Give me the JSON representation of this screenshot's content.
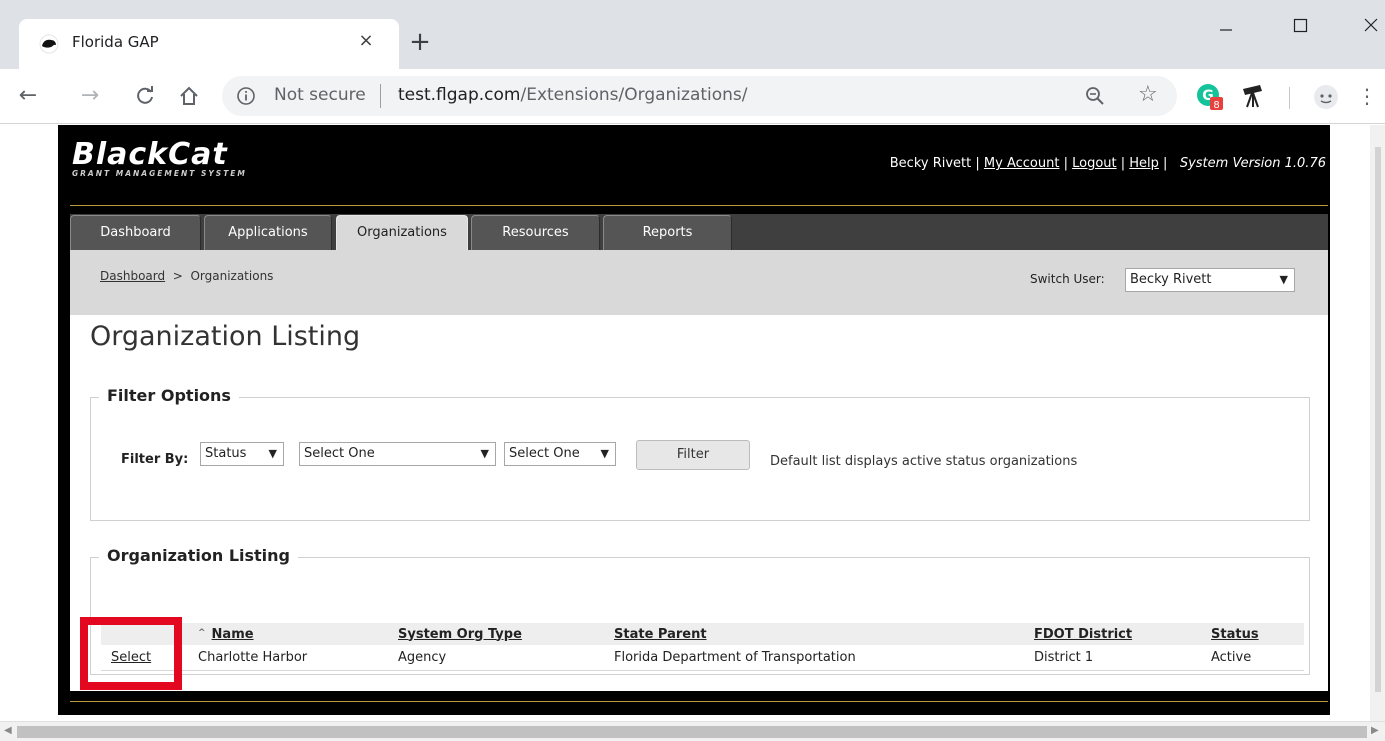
{
  "browser": {
    "tab_title": "Florida GAP",
    "tab_close": "×",
    "new_tab": "+",
    "minimize": "—",
    "close": "✕",
    "security_label": "Not secure",
    "url_host": "test.flgap.com",
    "url_path": "/Extensions/Organizations/",
    "extension_badge": "8"
  },
  "site": {
    "logo_text": "BlackCat",
    "logo_sub": "GRANT MANAGEMENT SYSTEM",
    "user_name": "Becky Rivett",
    "links": {
      "my_account": "My Account",
      "logout": "Logout",
      "help": "Help"
    },
    "separator": " | ",
    "version": "System Version  1.0.76"
  },
  "nav_tabs": [
    {
      "label": "Dashboard",
      "active": false
    },
    {
      "label": "Applications",
      "active": false
    },
    {
      "label": "Organizations",
      "active": true
    },
    {
      "label": "Resources",
      "active": false
    },
    {
      "label": "Reports",
      "active": false
    }
  ],
  "breadcrumb": {
    "home": "Dashboard",
    "separator": ">",
    "current": "Organizations"
  },
  "switch_user": {
    "label": "Switch User:",
    "value": "Becky Rivett"
  },
  "page_title": "Organization Listing",
  "filter": {
    "legend": "Filter Options",
    "label": "Filter By:",
    "select1": "Status",
    "select2": "Select One",
    "select3": "Select One",
    "button": "Filter",
    "note": "Default list displays active status organizations"
  },
  "listing": {
    "legend": "Organization Listing",
    "sort_caret": "^",
    "columns": [
      "",
      "Name",
      "System Org Type",
      "State Parent",
      "FDOT District",
      "Status"
    ],
    "rows": [
      {
        "select": "Select",
        "name": "Charlotte Harbor",
        "type": "Agency",
        "parent": "Florida Department of Transportation",
        "district": "District 1",
        "status": "Active"
      }
    ]
  },
  "colors": {
    "highlight": "#e3071f",
    "gold_rule": "#b99b3a",
    "active_tab": "#d9d9d9"
  }
}
